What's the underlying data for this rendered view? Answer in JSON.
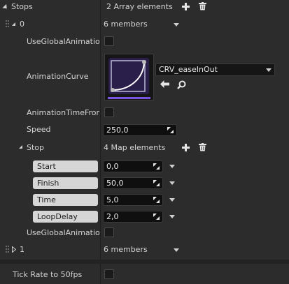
{
  "stops": {
    "label": "Stops",
    "count_text": "2 Array elements"
  },
  "element0": {
    "index": "0",
    "members_text": "6 members",
    "use_global_animation_curve": {
      "label": "UseGlobalAnimationC",
      "checked": false
    },
    "animation_curve": {
      "label": "AnimationCurve",
      "asset_name": "CRV_easeInOut"
    },
    "animation_time_from": {
      "label": "AnimationTimeFromS",
      "checked": false
    },
    "speed": {
      "label": "Speed",
      "value": "250,0"
    },
    "stop": {
      "label": "Stop",
      "count_text": "4 Map elements",
      "entries": [
        {
          "key": "Start",
          "value": "0,0"
        },
        {
          "key": "Finish",
          "value": "50,0"
        },
        {
          "key": "Time",
          "value": "5,0"
        },
        {
          "key": "LoopDelay",
          "value": "2,0"
        }
      ]
    },
    "use_global_animation_time": {
      "label": "UseGlobalAnimationT",
      "checked": false
    }
  },
  "element1": {
    "index": "1",
    "members_text": "6 members"
  },
  "tick_rate": {
    "label": "Tick Rate to 50fps",
    "checked": false
  },
  "colors": {
    "background": "#2c2c2c",
    "curve_accent": "#7a55e0",
    "curve_bg": "#2a1f4a"
  }
}
